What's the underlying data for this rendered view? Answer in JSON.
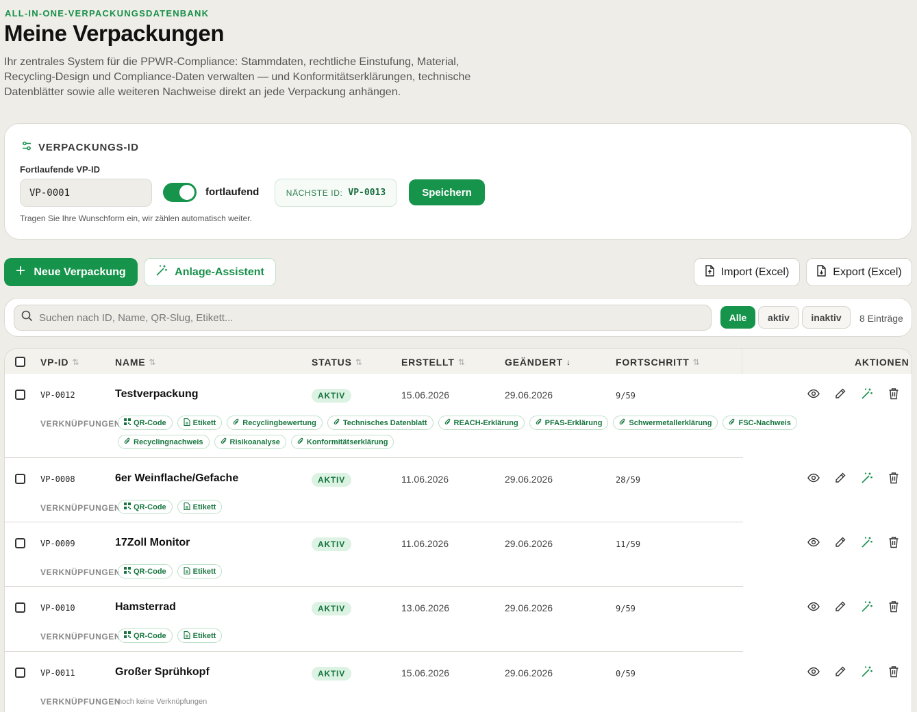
{
  "header": {
    "eyebrow": "ALL-IN-ONE-VERPACKUNGSDATENBANK",
    "title": "Meine Verpackungen",
    "intro": "Ihr zentrales System für die PPWR-Compliance: Stammdaten, rechtliche Einstufung, Material, Recycling-Design und Compliance-Daten verwalten — und Konformitätserklärungen, technische Datenblätter sowie alle weiteren Nachweise direkt an jede Verpackung anhängen."
  },
  "id_card": {
    "heading": "VERPACKUNGS-ID",
    "field_label": "Fortlaufende VP-ID",
    "field_value": "VP-0001",
    "toggle_label": "fortlaufend",
    "toggle_on": true,
    "next_id_label": "NÄCHSTE ID:",
    "next_id_value": "VP-0013",
    "save_label": "Speichern",
    "help": "Tragen Sie Ihre Wunschform ein, wir zählen automatisch weiter."
  },
  "toolbar": {
    "new_label": "Neue Verpackung",
    "wizard_label": "Anlage-Assistent",
    "import_label": "Import (Excel)",
    "export_label": "Export (Excel)"
  },
  "search": {
    "placeholder": "Suchen nach ID, Name, QR-Slug, Etikett...",
    "filters": [
      "Alle",
      "aktiv",
      "inaktiv"
    ],
    "active_filter": "Alle",
    "count": "8 Einträge"
  },
  "table": {
    "columns": {
      "vpid": "VP-ID",
      "name": "NAME",
      "status": "STATUS",
      "created": "ERSTELLT",
      "changed": "GEÄNDERT",
      "progress": "FORTSCHRITT",
      "actions": "AKTIONEN"
    },
    "links_label": "VERKNÜPFUNGEN",
    "rows": [
      {
        "vpid": "VP-0012",
        "name": "Testverpackung",
        "status": "AKTIV",
        "created": "15.06.2026",
        "changed": "29.06.2026",
        "progress": "9/59",
        "links": [
          "QR-Code",
          "Etikett",
          "Recyclingbewertung",
          "Technisches Datenblatt",
          "REACH-Erklärung",
          "PFAS-Erklärung",
          "Schwermetallerklärung",
          "FSC-Nachweis",
          "Recyclingnachweis",
          "Risikoanalyse",
          "Konformitätserklärung"
        ]
      },
      {
        "vpid": "VP-0008",
        "name": "6er Weinflache/Gefache",
        "status": "AKTIV",
        "created": "11.06.2026",
        "changed": "29.06.2026",
        "progress": "28/59",
        "links": [
          "QR-Code",
          "Etikett"
        ]
      },
      {
        "vpid": "VP-0009",
        "name": "17Zoll Monitor",
        "status": "AKTIV",
        "created": "11.06.2026",
        "changed": "29.06.2026",
        "progress": "11/59",
        "links": [
          "QR-Code",
          "Etikett"
        ]
      },
      {
        "vpid": "VP-0010",
        "name": "Hamsterrad",
        "status": "AKTIV",
        "created": "13.06.2026",
        "changed": "29.06.2026",
        "progress": "9/59",
        "links": [
          "QR-Code",
          "Etikett"
        ]
      },
      {
        "vpid": "VP-0011",
        "name": "Großer Sprühkopf",
        "status": "AKTIV",
        "created": "15.06.2026",
        "changed": "29.06.2026",
        "progress": "0/59",
        "links": [],
        "no_links_text": "noch keine Verknüpfungen"
      }
    ]
  },
  "colors": {
    "accent": "#17944b",
    "background": "#efede7"
  }
}
